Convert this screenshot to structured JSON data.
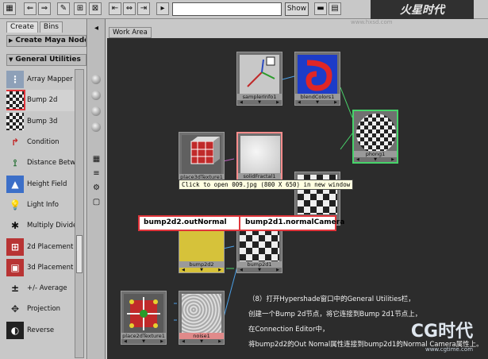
{
  "toolbar": {
    "search_value": "",
    "show_label": "Show",
    "brand": "火星时代",
    "site_credit": "www.hxsd.com"
  },
  "left_panel": {
    "tabs": [
      {
        "label": "Create"
      },
      {
        "label": "Bins"
      }
    ],
    "create_header": "Create Maya Nodes",
    "section_header": "General Utilities",
    "nodes": [
      {
        "label": "Array Mapper",
        "icon": "array-mapper-icon"
      },
      {
        "label": "Bump 2d",
        "icon": "bump2d-icon",
        "selected": true
      },
      {
        "label": "Bump 3d",
        "icon": "bump3d-icon"
      },
      {
        "label": "Condition",
        "icon": "condition-icon"
      },
      {
        "label": "Distance Between",
        "icon": "distance-between-icon"
      },
      {
        "label": "Height Field",
        "icon": "height-field-icon"
      },
      {
        "label": "Light Info",
        "icon": "light-info-icon"
      },
      {
        "label": "Multiply Divide",
        "icon": "multiply-divide-icon"
      },
      {
        "label": "2d Placement",
        "icon": "place2d-icon"
      },
      {
        "label": "3d Placement",
        "icon": "place3d-icon"
      },
      {
        "label": "+/- Average",
        "icon": "plus-minus-average-icon"
      },
      {
        "label": "Projection",
        "icon": "projection-icon"
      },
      {
        "label": "Reverse",
        "icon": "reverse-icon"
      }
    ],
    "scroll_position": 0.55
  },
  "work_area": {
    "tab_label": "Work Area",
    "nodes": [
      {
        "id": "samplerInfo1",
        "label": "samplerInfo1"
      },
      {
        "id": "blendColors1",
        "label": "blendColors1"
      },
      {
        "id": "phong1",
        "label": "phong1"
      },
      {
        "id": "place3dTexture1",
        "label": "place3dTexture1"
      },
      {
        "id": "solidFractal1",
        "label": "solidFractal1"
      },
      {
        "id": "bump2d2",
        "label": "bump2d2"
      },
      {
        "id": "bump2d1",
        "label": "bump2d1"
      },
      {
        "id": "place2dTexture1",
        "label": "place2dTexture1"
      },
      {
        "id": "noise1",
        "label": "noise1"
      }
    ],
    "tooltip": "Click to open 009.jpg (800 X 650) in new window",
    "callout_left": "bump2d2.outNormal",
    "callout_right": "bump2d1.normalCamera",
    "note_lines": [
      "（8）打开Hypershade窗口中的General Utilities栏，",
      "创建一个Bump 2d节点，将它连接到Bump 2d1节点上，",
      "在Connection Editor中，",
      "将bump2d2的Out Nomal属性连接到bump2d1的Normal Camera属性上。"
    ],
    "logo": "CG时代",
    "logo_url": "www.cgtime.com"
  }
}
